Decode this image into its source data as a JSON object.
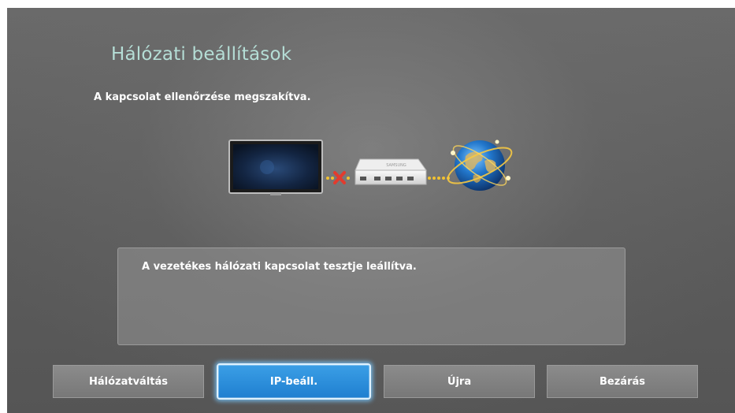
{
  "header": {
    "title": "Hálózati beállítások"
  },
  "status": {
    "message": "A kapcsolat ellenőrzése megszakítva."
  },
  "diagram": {
    "devices": [
      "tv-icon",
      "router-icon",
      "globe-icon"
    ],
    "link_tv_router": "disconnected",
    "link_router_internet": "connected",
    "router_brand": "SAMSUNG",
    "error_color": "#e23b2e",
    "link_color": "#f2c230"
  },
  "info": {
    "message": "A vezetékes hálózati kapcsolat tesztje leállítva."
  },
  "buttons": {
    "network_switch": "Hálózatváltás",
    "ip_settings": "IP-beáll.",
    "retry": "Újra",
    "close": "Bezárás"
  },
  "focused_button": "ip_settings",
  "colors": {
    "title": "#b5ded6",
    "focus": "#2a8ddb"
  }
}
